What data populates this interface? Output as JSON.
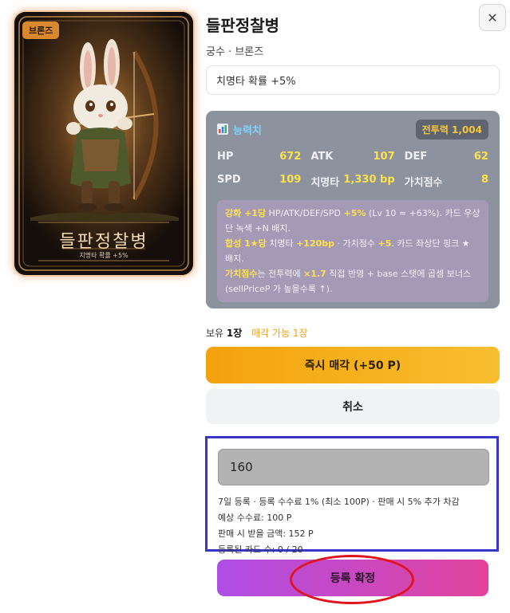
{
  "card": {
    "rarity": "브론즈",
    "art_name": "들판정찰병",
    "art_effect": "치명타 확률 +5%"
  },
  "header": {
    "title": "들판정찰병",
    "subline": "궁수 · 브론즈",
    "close_icon": "close-icon"
  },
  "effect": "치명타 확률 +5%",
  "stats": {
    "icon": "bar-chart-icon",
    "title": "능력치",
    "power_label": "전투력 1,004",
    "rows": [
      [
        {
          "label": "HP",
          "value": "672"
        },
        {
          "label": "ATK",
          "value": "107"
        },
        {
          "label": "DEF",
          "value": "62"
        }
      ],
      [
        {
          "label": "SPD",
          "value": "109"
        },
        {
          "label": "치명타",
          "value": "1,330 bp"
        },
        {
          "label": "가치점수",
          "value": "8"
        }
      ]
    ],
    "info": {
      "l1_hl": "강화 +1당",
      "l1_a": " HP/ATK/DEF/SPD ",
      "l1_hl2": "+5%",
      "l1_b": " (Lv 10 ≈ +63%). 카드 우상단 녹색 +N 배지.",
      "l2_hl": "합성 1★당",
      "l2_a": " 치명타 ",
      "l2_hl2": "+120bp",
      "l2_b": " · 가치점수 ",
      "l2_hl3": "+5",
      "l2_c": ". 카드 좌상단 핑크 ★ 배지.",
      "l3_hl": "가치점수",
      "l3_a": "는 전투력에 ",
      "l3_hl2": "×1.7",
      "l3_b": " 직접 반영 + base 스탯에 곱셈 보너스 (sellPriceP 가 높을수록 ↑)."
    }
  },
  "holdings": {
    "own_prefix": "보유 ",
    "own_count": "1장",
    "sellable": "매각 가능 1장"
  },
  "buttons": {
    "instant_sell": "즉시 매각 (+50 P)",
    "cancel": "취소",
    "confirm": "등록 확정"
  },
  "listing": {
    "price_value": "160",
    "info_lines": [
      "7일 등록 · 등록 수수료 1% (최소 100P) · 판매 시 5% 추가 차감",
      "예상 수수료: 100 P",
      "판매 시 받을 금액: 152 P",
      "등록된 카드 수: 0 / 20"
    ]
  },
  "colors": {
    "sell_button": "#f4a20d",
    "confirm_button": "#c24bc7",
    "stat_value": "#ffe14a",
    "highlight_box": "#3a35c9",
    "annotation_ring": "#e0141e"
  }
}
